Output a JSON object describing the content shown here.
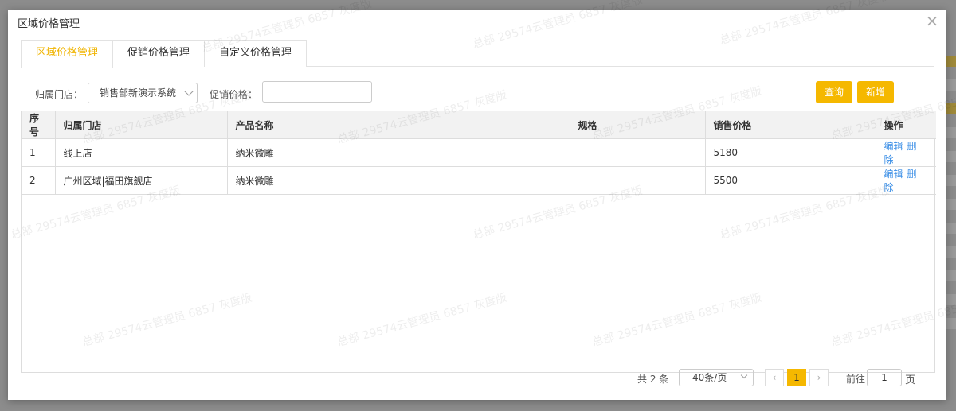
{
  "modal": {
    "title": "区域价格管理"
  },
  "tabs": [
    {
      "label": "区域价格管理"
    },
    {
      "label": "促销价格管理"
    },
    {
      "label": "自定义价格管理"
    }
  ],
  "filters": {
    "store_label": "归属门店：",
    "store_value": "销售部新演示系统",
    "price_label": "促销价格：",
    "price_value": "",
    "query_label": "查询",
    "add_label": "新增"
  },
  "table": {
    "headers": [
      "序号",
      "归属门店",
      "产品名称",
      "规格",
      "销售价格",
      "操作"
    ],
    "rows": [
      {
        "idx": "1",
        "store": "线上店",
        "product": "纳米微雕",
        "spec": "",
        "price": "5180"
      },
      {
        "idx": "2",
        "store": "广州区域|福田旗舰店",
        "product": "纳米微雕",
        "spec": "",
        "price": "5500"
      }
    ],
    "edit_label": "编辑",
    "delete_label": "删除"
  },
  "pagination": {
    "total": "共 2 条",
    "page_size": "40条/页",
    "current_page": "1",
    "goto_label": "前往",
    "goto_value": "1",
    "page_suffix": "页"
  },
  "watermark": "总部 29574云管理员 6857 灰度版",
  "icons": {
    "close": "close-icon",
    "chevron_down": "chevron-down-icon",
    "prev": "chevron-left-icon",
    "next": "chevron-right-icon"
  }
}
